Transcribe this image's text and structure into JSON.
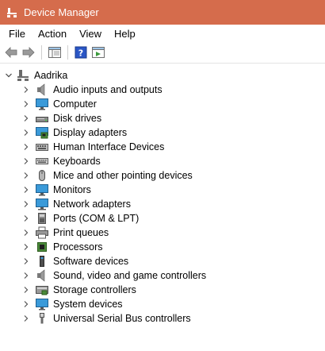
{
  "window": {
    "title": "Device Manager"
  },
  "menu": [
    "File",
    "Action",
    "View",
    "Help"
  ],
  "tree": {
    "root": "Aadrika",
    "items": [
      {
        "label": "Audio inputs and outputs",
        "icon": "speaker-icon"
      },
      {
        "label": "Computer",
        "icon": "monitor-icon"
      },
      {
        "label": "Disk drives",
        "icon": "disk-drive-icon"
      },
      {
        "label": "Display adapters",
        "icon": "display-adapter-icon"
      },
      {
        "label": "Human Interface Devices",
        "icon": "hid-icon"
      },
      {
        "label": "Keyboards",
        "icon": "keyboard-icon"
      },
      {
        "label": "Mice and other pointing devices",
        "icon": "mouse-icon"
      },
      {
        "label": "Monitors",
        "icon": "monitor-icon"
      },
      {
        "label": "Network adapters",
        "icon": "network-adapter-icon"
      },
      {
        "label": "Ports (COM & LPT)",
        "icon": "port-icon"
      },
      {
        "label": "Print queues",
        "icon": "printer-icon"
      },
      {
        "label": "Processors",
        "icon": "processor-icon"
      },
      {
        "label": "Software devices",
        "icon": "software-device-icon"
      },
      {
        "label": "Sound, video and game controllers",
        "icon": "speaker-icon"
      },
      {
        "label": "Storage controllers",
        "icon": "storage-controller-icon"
      },
      {
        "label": "System devices",
        "icon": "system-device-icon"
      },
      {
        "label": "Universal Serial Bus controllers",
        "icon": "usb-icon"
      }
    ]
  },
  "colors": {
    "titlebar": "#d56c4c",
    "selection": "#cce8ff"
  }
}
